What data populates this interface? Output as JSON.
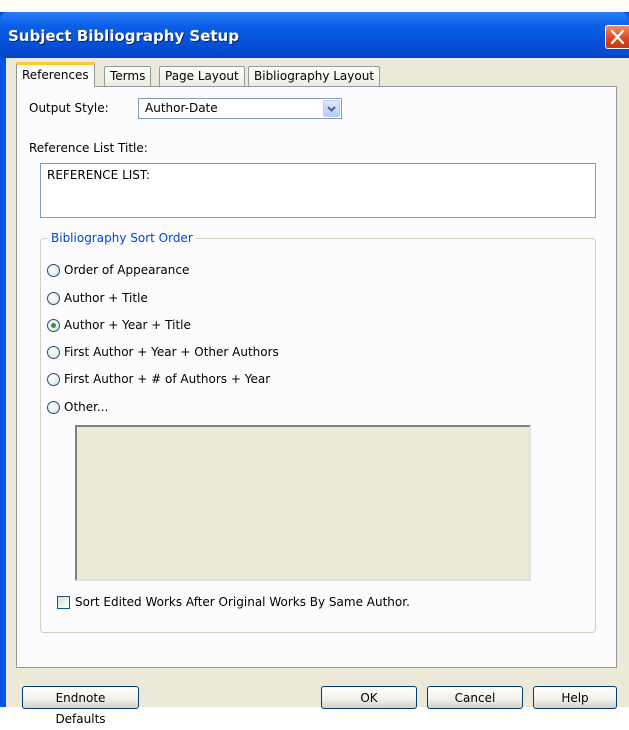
{
  "window": {
    "title": "Subject Bibliography Setup"
  },
  "tabs": [
    {
      "label": "References",
      "active": true
    },
    {
      "label": "Terms",
      "active": false
    },
    {
      "label": "Page Layout",
      "active": false
    },
    {
      "label": "Bibliography Layout",
      "active": false
    }
  ],
  "references": {
    "output_style_label": "Output Style:",
    "output_style_value": "Author-Date",
    "reference_list_title_label": "Reference List Title:",
    "reference_list_title_value": "REFERENCE LIST:"
  },
  "sort_order": {
    "legend": "Bibliography Sort Order",
    "options": [
      {
        "label": "Order of Appearance",
        "selected": false
      },
      {
        "label": "Author + Title",
        "selected": false
      },
      {
        "label": "Author + Year + Title",
        "selected": true
      },
      {
        "label": "First Author + Year + Other Authors",
        "selected": false
      },
      {
        "label": "First Author +  # of Authors + Year",
        "selected": false
      },
      {
        "label": "Other...",
        "selected": false
      }
    ],
    "sort_edited_label": "Sort Edited Works After Original Works By Same Author.",
    "sort_edited_checked": false
  },
  "buttons": {
    "endnote_defaults": "Endnote Defaults",
    "ok": "OK",
    "cancel": "Cancel",
    "help": "Help"
  },
  "colors": {
    "title_bar": "#0a5fe6",
    "close_button": "#d9441c",
    "dialog_background": "#ece9d8",
    "group_legend": "#0046d5",
    "radio_selected": "#21a121"
  }
}
